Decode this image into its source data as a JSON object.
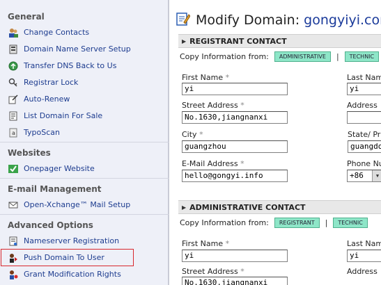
{
  "sidebar": {
    "sections": [
      {
        "title": "General"
      },
      {
        "title": "Websites"
      },
      {
        "title": "E-mail Management"
      },
      {
        "title": "Advanced Options"
      }
    ],
    "items": [
      {
        "label": "Change Contacts",
        "icon": "contacts-icon"
      },
      {
        "label": "Domain Name Server Setup",
        "icon": "server-icon"
      },
      {
        "label": "Transfer DNS Back to Us",
        "icon": "transfer-icon"
      },
      {
        "label": "Registrar Lock",
        "icon": "lock-icon"
      },
      {
        "label": "Auto-Renew",
        "icon": "renew-icon"
      },
      {
        "label": "List Domain For Sale",
        "icon": "sale-icon"
      },
      {
        "label": "TypoScan",
        "icon": "typoscan-icon"
      },
      {
        "label": "Onepager Website",
        "icon": "check-icon"
      },
      {
        "label": "Open-Xchange™ Mail Setup",
        "icon": "mail-icon"
      },
      {
        "label": "Nameserver Registration",
        "icon": "nameserver-icon"
      },
      {
        "label": "Push Domain To User",
        "icon": "push-user-icon"
      },
      {
        "label": "Grant Modification Rights",
        "icon": "grant-icon"
      }
    ]
  },
  "page": {
    "title_prefix": "Modify Domain:",
    "domain": "gongyiyi.com"
  },
  "registrant": {
    "header": "REGISTRANT CONTACT",
    "copy_label": "Copy Information from:",
    "copy_btn1": "ADMINISTRATIVE",
    "copy_btn2": "TECHNIC",
    "pipe": "|",
    "first_name_label": "First Name",
    "first_name": "yi",
    "last_name_label": "Last Nam",
    "last_name": "yi",
    "street_label": "Street Address",
    "street": "No.1630,jiangnanxi",
    "address2_label": "Address",
    "address2": "",
    "city_label": "City",
    "city": "guangzhou",
    "state_label": "State/ Pr",
    "state": "guangdo",
    "email_label": "E-Mail Address",
    "email": "hello@gongyi.info",
    "phone_label": "Phone Nu",
    "phone_code": "+86"
  },
  "administrative": {
    "header": "ADMINISTRATIVE CONTACT",
    "copy_label": "Copy Information from:",
    "copy_btn1": "REGISTRANT",
    "copy_btn2": "TECHNIC",
    "pipe": "|",
    "first_name_label": "First Name",
    "first_name": "yi",
    "last_name_label": "Last Nam",
    "last_name": "yi",
    "street_label": "Street Address",
    "street": "No.1630,jiangnanxi",
    "address2_label": "Address"
  },
  "required_mark": "*",
  "colors": {
    "accent": "#1d3c8f",
    "pill": "#8ee6c8",
    "highlight": "#d8262c"
  }
}
